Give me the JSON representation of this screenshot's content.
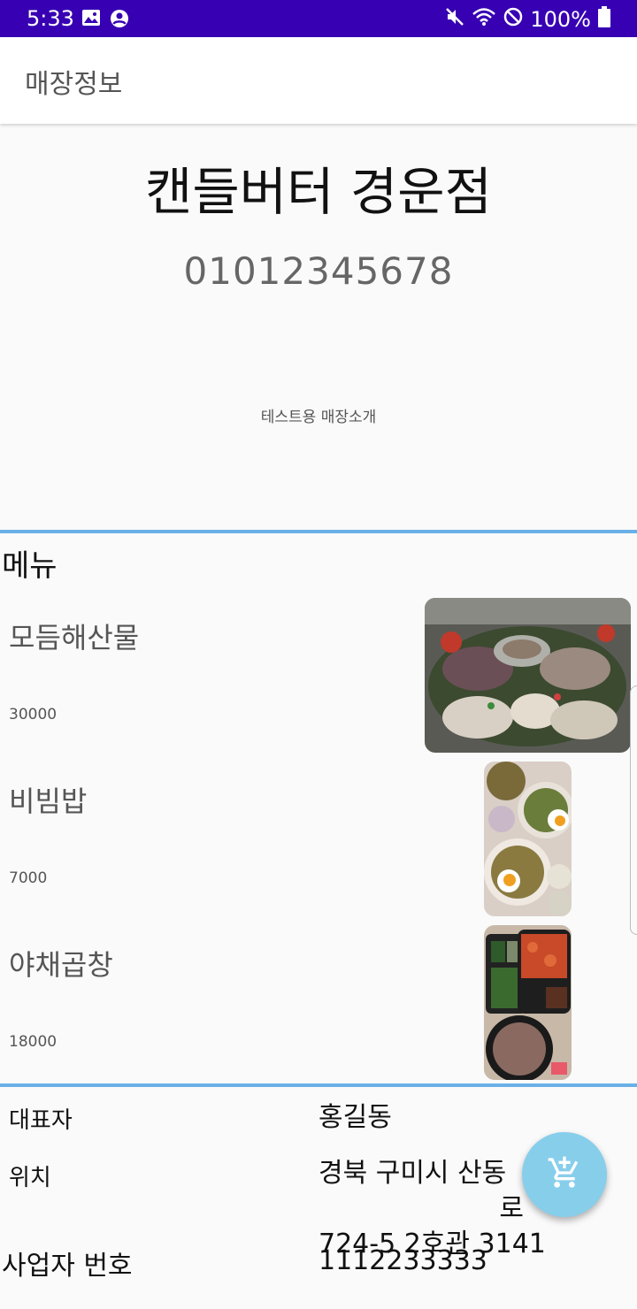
{
  "status_bar": {
    "time": "5:33",
    "battery_text": "100%",
    "icons": [
      "image-icon",
      "account-circle-icon",
      "mute-icon",
      "wifi-icon",
      "do-not-disturb-icon",
      "battery-icon"
    ]
  },
  "app_bar": {
    "title": "매장정보"
  },
  "store": {
    "name": "캔들버터 경운점",
    "phone": "01012345678",
    "intro": "테스트용 매장소개"
  },
  "menu": {
    "heading": "메뉴",
    "items": [
      {
        "name": "모듬해산물",
        "price": "30000",
        "image": "seafood-platter-photo"
      },
      {
        "name": "비빔밥",
        "price": "7000",
        "image": "bibimbap-photo"
      },
      {
        "name": "야채곱창",
        "price": "18000",
        "image": "gopchang-photo"
      }
    ]
  },
  "info": {
    "owner_label": "대표자",
    "owner_value": "홍길동",
    "location_label": "위치",
    "location_line1": "경북 구미시 산동",
    "location_line1_end": "로",
    "location_line2": "724-5 2호관 3141",
    "business_label": "사업자 번호",
    "business_value": "1112233333"
  },
  "fab": {
    "icon": "add-shopping-cart-icon"
  },
  "colors": {
    "status_bar": "#3700b3",
    "divider": "#6ab0e8",
    "fab": "#87ceeb"
  }
}
